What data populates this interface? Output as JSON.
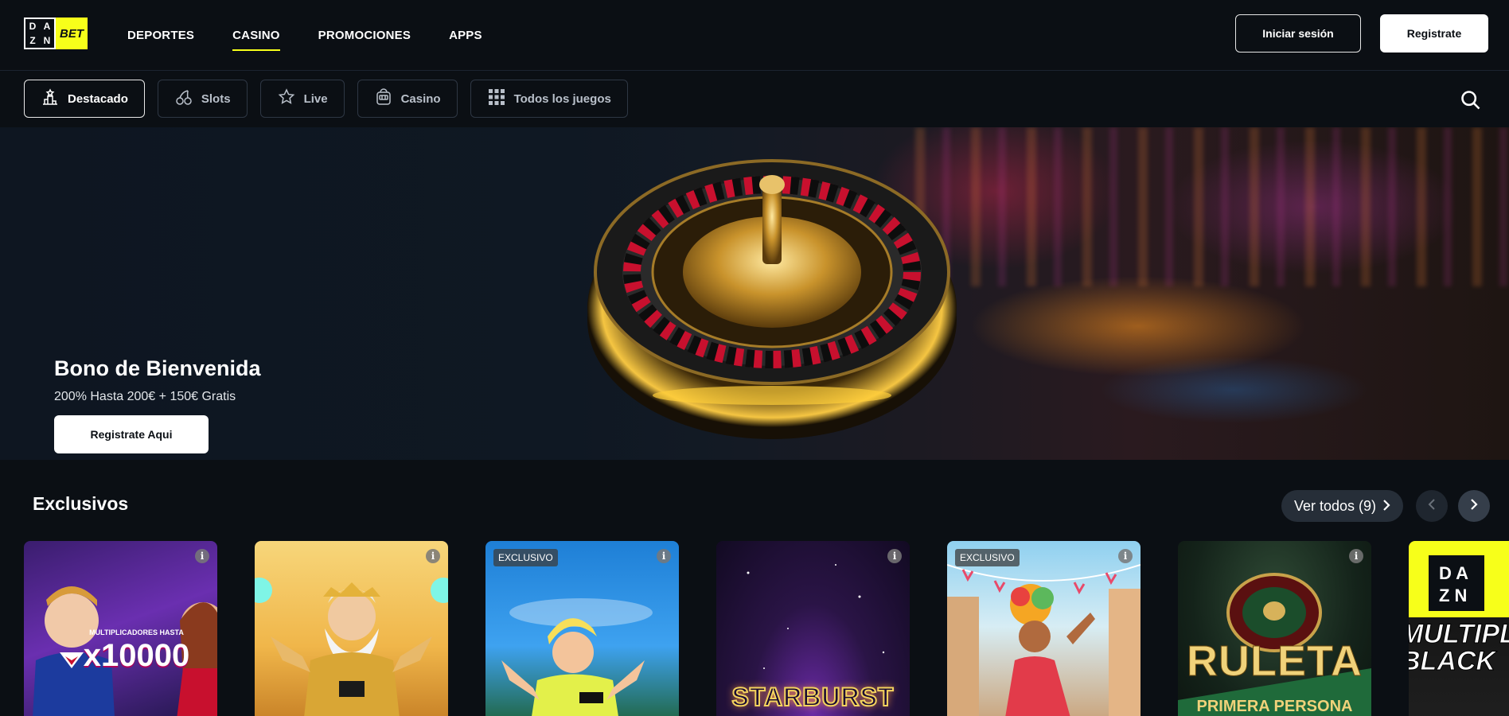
{
  "header": {
    "logo": {
      "dazn_letters": [
        "D",
        "A",
        "Z",
        "N"
      ],
      "bet": "BET"
    },
    "nav": [
      "DEPORTES",
      "CASINO",
      "PROMOCIONES",
      "APPS"
    ],
    "active_nav": "CASINO",
    "login_label": "Iniciar sesión",
    "register_label": "Registrate"
  },
  "categories": {
    "items": [
      {
        "label": "Destacado",
        "icon": "podium-icon",
        "active": true
      },
      {
        "label": "Slots",
        "icon": "cherries-icon",
        "active": false
      },
      {
        "label": "Live",
        "icon": "star-icon",
        "active": false
      },
      {
        "label": "Casino",
        "icon": "slot-machine-icon",
        "active": false
      },
      {
        "label": "Todos los juegos",
        "icon": "grid-icon",
        "active": false
      }
    ],
    "search_icon": "search-icon"
  },
  "hero": {
    "title": "Bono de Bienvenida",
    "subtitle": "200% Hasta 200€ + 150€ Gratis",
    "cta": "Registrate Aqui"
  },
  "section": {
    "title": "Exclusivos",
    "see_all": "Ver todos (9)"
  },
  "games": [
    {
      "name": "multiplicadores-game",
      "badge": "",
      "art_text": "MULTIPLICADORES HASTA",
      "art_value": "x10000"
    },
    {
      "name": "zeus-game",
      "badge": "",
      "art_text": "",
      "art_value": ""
    },
    {
      "name": "football-game",
      "badge": "EXCLUSIVO",
      "art_text": "",
      "art_value": ""
    },
    {
      "name": "starburst-game",
      "badge": "",
      "art_text": "STARBURST",
      "art_value": ""
    },
    {
      "name": "fiesta-game",
      "badge": "EXCLUSIVO",
      "art_text": "",
      "art_value": ""
    },
    {
      "name": "ruleta-game",
      "badge": "",
      "art_text": "RULETA",
      "art_value": "PRIMERA PERSONA"
    },
    {
      "name": "multiplier-blackjack-game",
      "badge": "",
      "art_text": "MULTIPL",
      "art_value": "BLACK"
    }
  ],
  "colors": {
    "background": "#0b0f14",
    "accent_yellow": "#f7ff1a",
    "pill_border": "#2e3744",
    "button_dark": "#262e38"
  }
}
